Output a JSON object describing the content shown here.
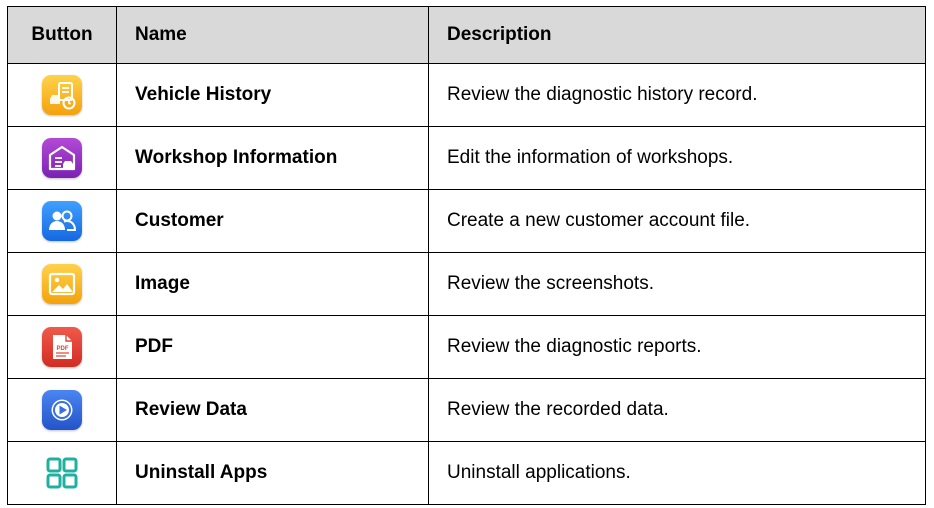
{
  "table": {
    "headers": {
      "button": "Button",
      "name": "Name",
      "description": "Description"
    },
    "rows": [
      {
        "icon": "vehicle-history-icon",
        "name": "Vehicle History",
        "description": "Review the diagnostic history record."
      },
      {
        "icon": "workshop-information-icon",
        "name": "Workshop Information",
        "description": "Edit the information of workshops."
      },
      {
        "icon": "customer-icon",
        "name": "Customer",
        "description": "Create a new customer account file."
      },
      {
        "icon": "image-icon",
        "name": "Image",
        "description": "Review the screenshots."
      },
      {
        "icon": "pdf-icon",
        "name": "PDF",
        "description": "Review the diagnostic reports."
      },
      {
        "icon": "review-data-icon",
        "name": "Review Data",
        "description": "Review the recorded data."
      },
      {
        "icon": "uninstall-apps-icon",
        "name": "Uninstall Apps",
        "description": "Uninstall applications."
      }
    ]
  },
  "icon_text": {
    "pdf_glyph": "PDF"
  },
  "colors": {
    "header_bg": "#d9d9d9",
    "border": "#000000",
    "vehicle_history_icon": "#f5b21c",
    "workshop_information_icon": "#9433c4",
    "customer_icon": "#2a86f2",
    "image_icon": "#f5b21c",
    "pdf_icon": "#e2412f",
    "review_data_icon": "#3672df",
    "uninstall_apps_icon": "#1fb0a0"
  }
}
